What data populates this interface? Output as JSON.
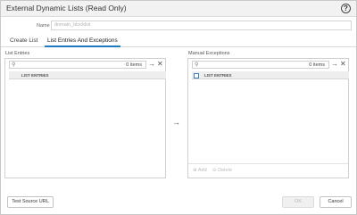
{
  "dialog": {
    "title": "External Dynamic Lists (Read Only)",
    "help_icon": "question-mark-circle"
  },
  "name": {
    "label": "Name",
    "value": "domain_blocklist"
  },
  "tabs": [
    {
      "label": "Create List",
      "active": false
    },
    {
      "label": "List Entries And Exceptions",
      "active": true
    }
  ],
  "list_entries": {
    "label": "List Entries",
    "count": "0 items",
    "column_header": "LIST ENTRIES"
  },
  "manual_exceptions": {
    "label": "Manual Exceptions",
    "count": "0 items",
    "column_header": "LIST ENTRIES",
    "add_label": "Add",
    "delete_label": "Delete"
  },
  "footer": {
    "test_source_url": "Test Source URL",
    "ok": "OK",
    "cancel": "Cancel"
  },
  "colors": {
    "accent": "#1f7bbf"
  }
}
